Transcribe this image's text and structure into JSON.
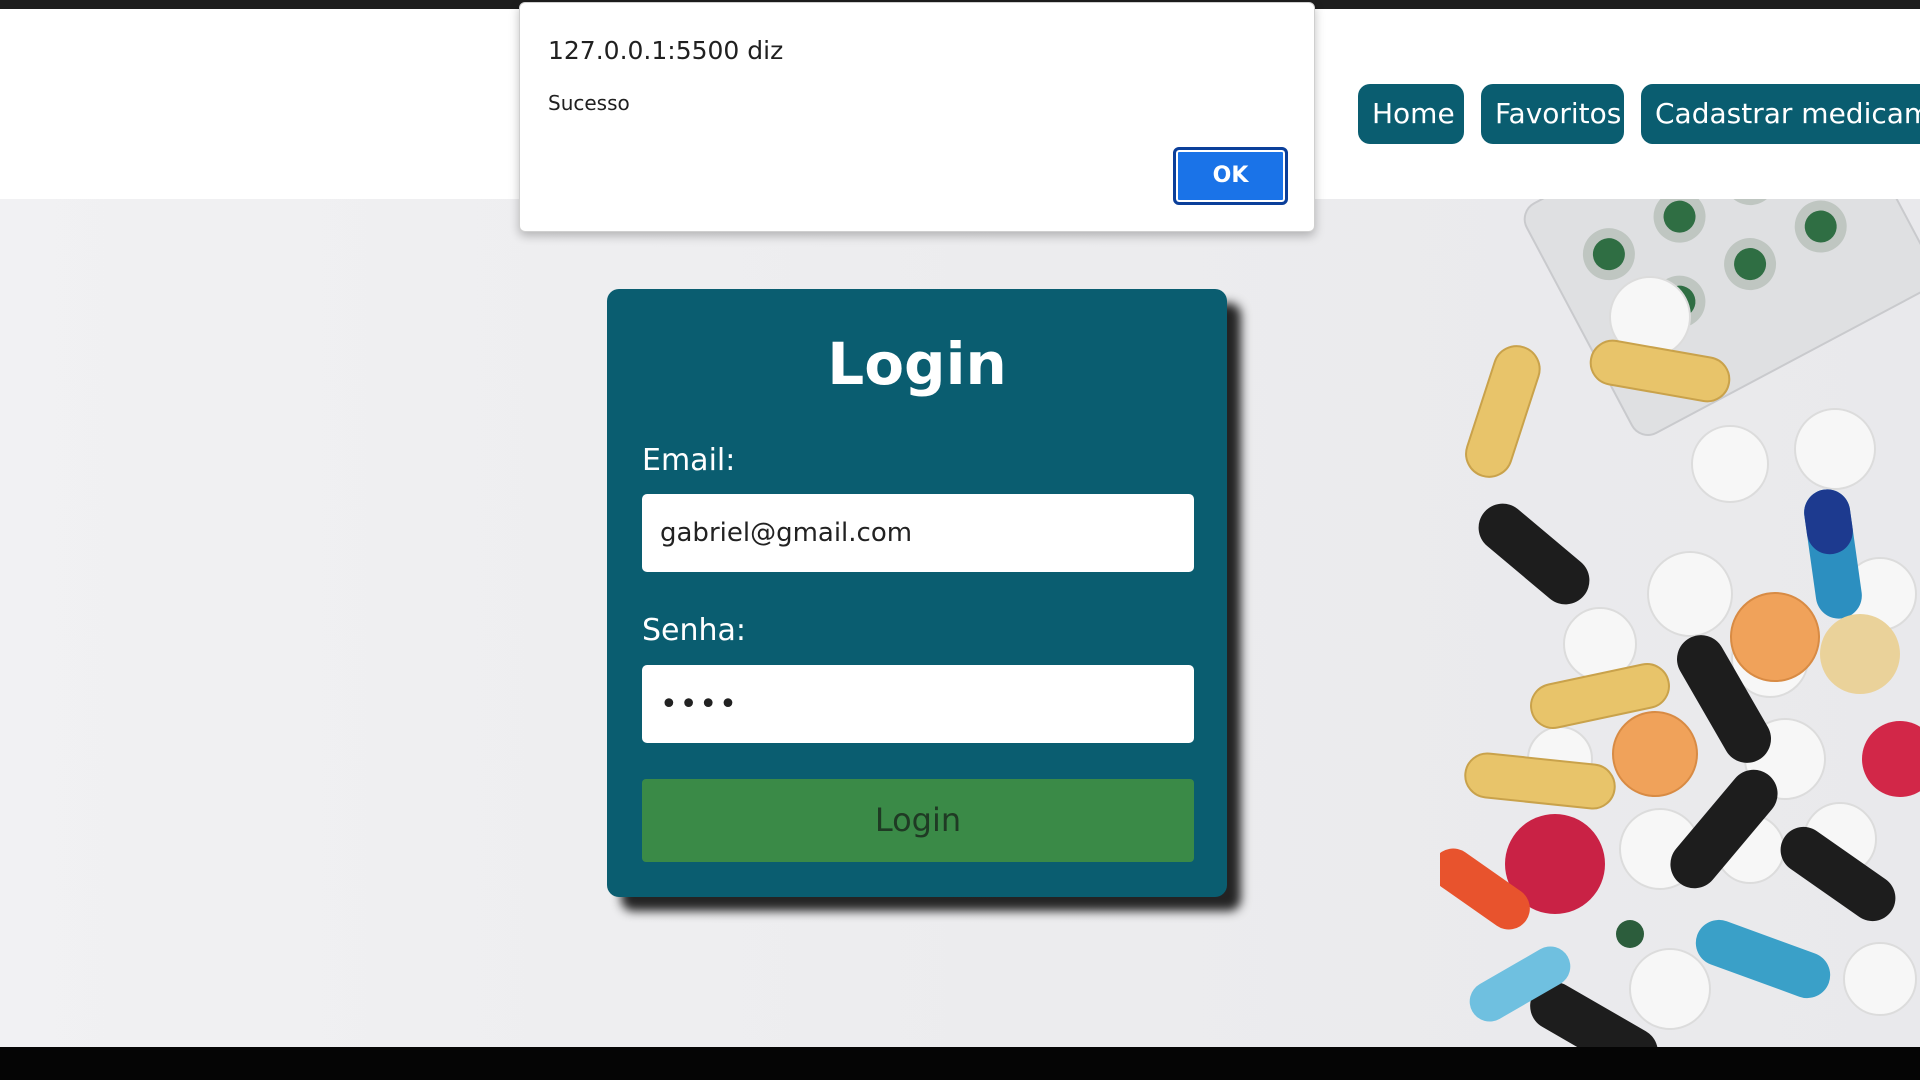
{
  "nav": {
    "items": [
      {
        "label": "Home"
      },
      {
        "label": "Favoritos"
      },
      {
        "label": "Cadastrar medicamentos"
      }
    ]
  },
  "login_card": {
    "title": "Login",
    "email_label": "Email:",
    "email_value": "gabriel@gmail.com",
    "password_label": "Senha:",
    "password_value": "••••",
    "submit_label": "Login"
  },
  "alert_dialog": {
    "origin": "127.0.0.1:5500 diz",
    "message": "Sucesso",
    "ok_label": "OK"
  },
  "colors": {
    "primary": "#0a5d70",
    "button_green": "#3a8a47",
    "dialog_ok_blue": "#1a73e8"
  }
}
